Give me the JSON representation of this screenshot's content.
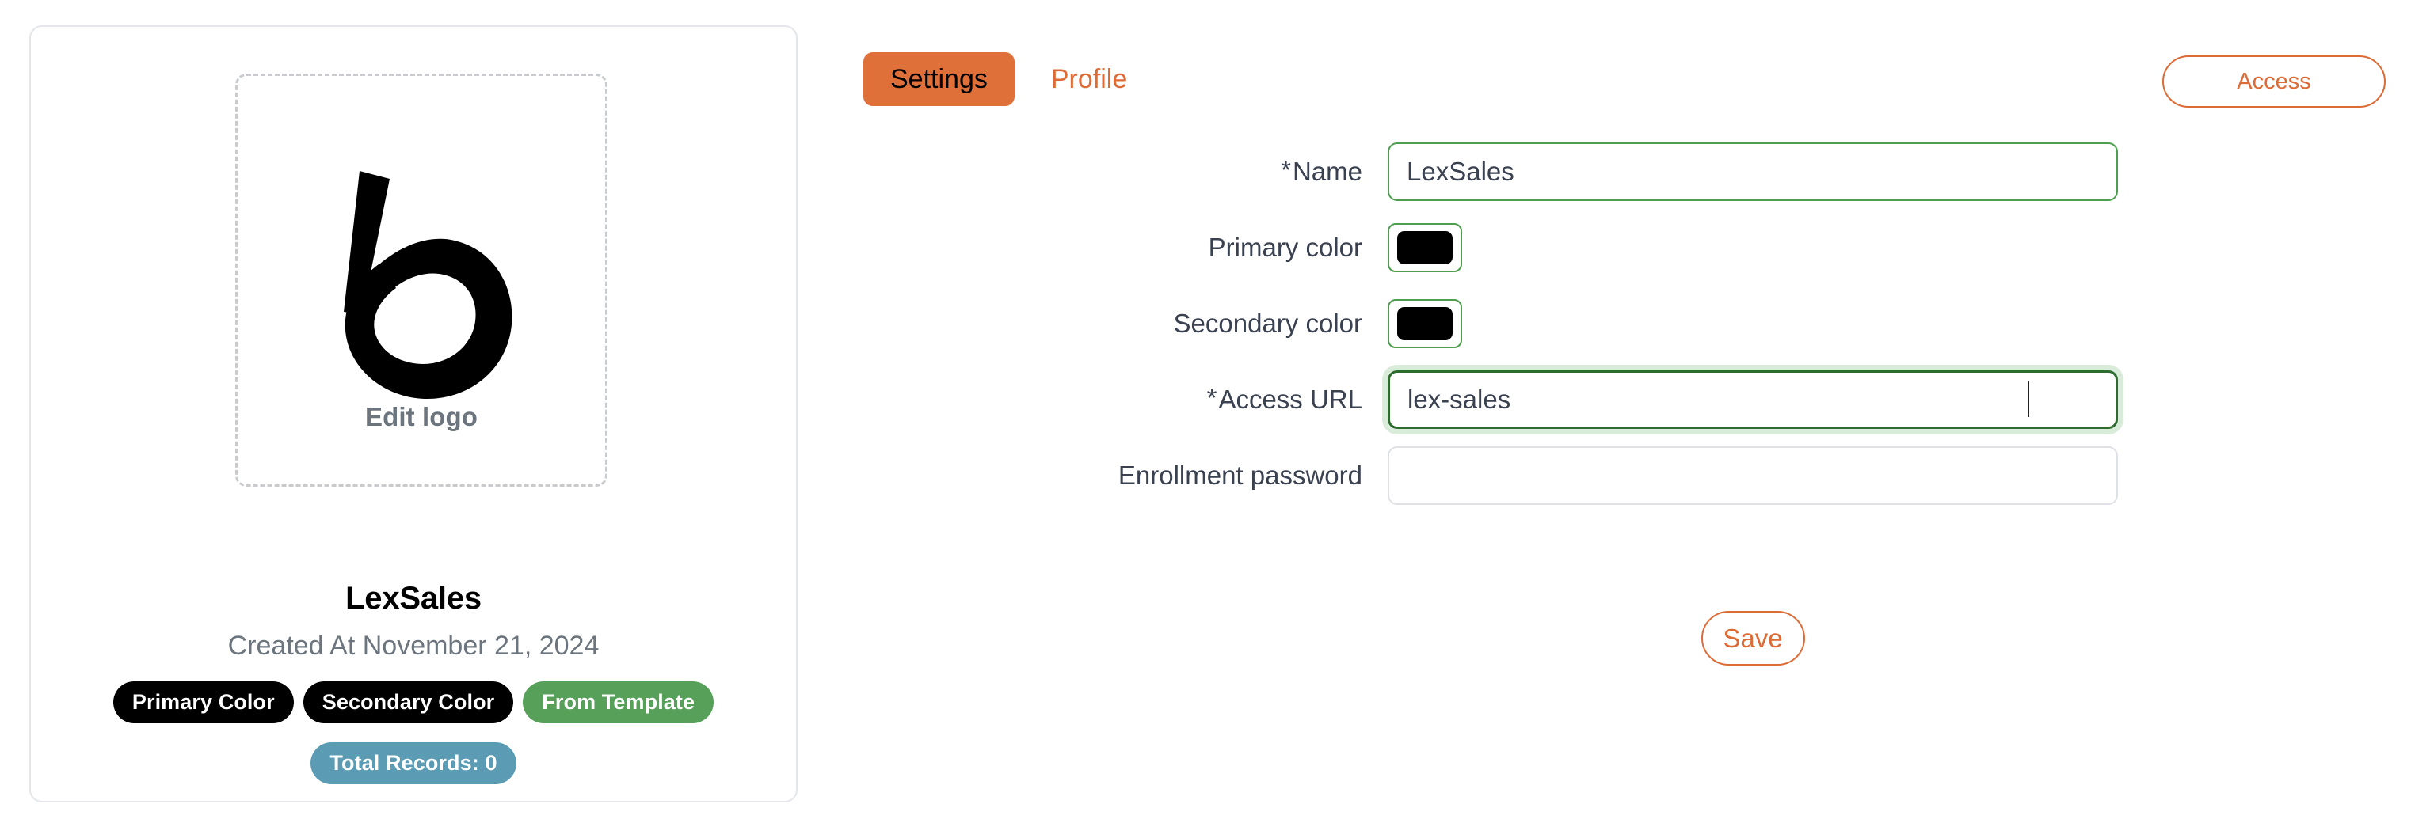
{
  "workspace": {
    "logo_alt": "stylized-b-logo",
    "edit_logo_label": "Edit logo",
    "name": "LexSales",
    "created_at": "Created At November 21, 2024",
    "badges": [
      {
        "label": "Primary Color",
        "style": "dark"
      },
      {
        "label": "Secondary Color",
        "style": "dark"
      },
      {
        "label": "From Template",
        "style": "green"
      },
      {
        "label": "Total Records: 0",
        "style": "teal"
      }
    ]
  },
  "tabs": [
    {
      "label": "Settings",
      "active": true
    },
    {
      "label": "Profile",
      "active": false
    }
  ],
  "header": {
    "access_label": "Access"
  },
  "form": {
    "required_marker": "*",
    "fields": {
      "name": {
        "label": "Name",
        "value": "LexSales",
        "placeholder": ""
      },
      "primary_color": {
        "label": "Primary color",
        "value": "#000000"
      },
      "secondary_color": {
        "label": "Secondary color",
        "value": "#000000"
      },
      "access_url": {
        "label": "Access URL",
        "value": "lex-sales",
        "placeholder": ""
      },
      "enrollment_password": {
        "label": "Enrollment password",
        "value": "",
        "placeholder": ""
      }
    },
    "save_label": "Save"
  },
  "colors": {
    "accent_orange": "#dd6b36",
    "tab_active_bg": "#e0703a",
    "input_border_green": "#4d9f4f",
    "input_border_focus": "#2d6b2f",
    "badge_green": "#56a05a",
    "badge_teal": "#5b9cb4",
    "badge_dark": "#000000",
    "card_border": "#e4e6ec",
    "muted_text": "#6c757d"
  }
}
